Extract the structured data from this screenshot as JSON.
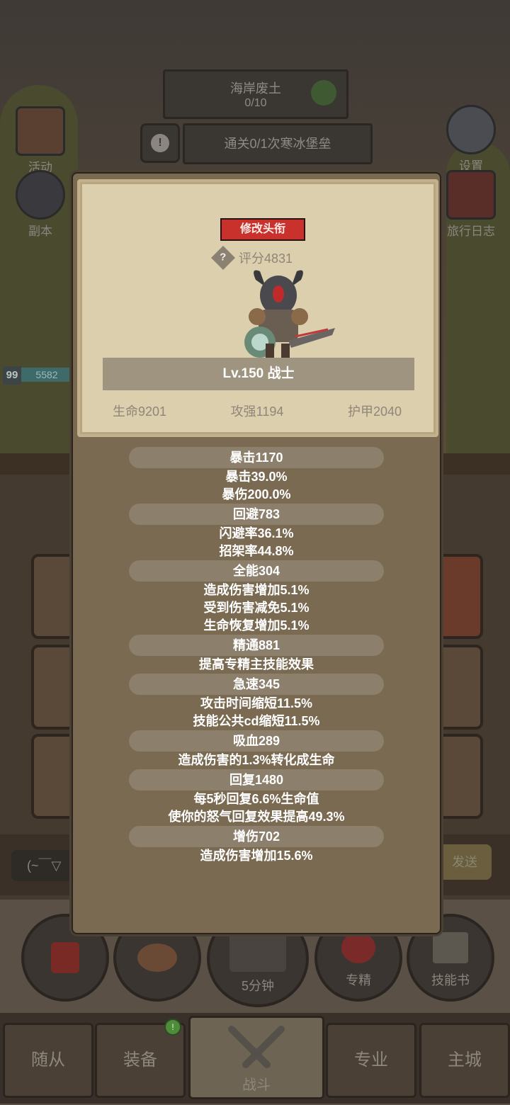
{
  "hud": {
    "zone_name": "海岸废土",
    "zone_progress": "0/10",
    "quest_text": "通关0/1次寒冰堡垒",
    "player_level": "99",
    "xp_value": "5582"
  },
  "side_buttons": {
    "left": [
      {
        "label": "活动",
        "icon": "scroll-icon"
      },
      {
        "label": "副本",
        "icon": "portal-icon"
      }
    ],
    "right": [
      {
        "label": "设置",
        "icon": "gear-icon"
      },
      {
        "label": "旅行日志",
        "icon": "book-icon"
      }
    ]
  },
  "chat": {
    "input_text": "(~￣▽",
    "send_label": "发送"
  },
  "action_buttons": [
    {
      "label": "",
      "icon": "potion-icon"
    },
    {
      "label": "",
      "icon": "bread-icon"
    },
    {
      "label": "5分钟",
      "icon": "chest-icon"
    },
    {
      "label": "专精",
      "icon": "specialization-icon"
    },
    {
      "label": "技能书",
      "icon": "skillbook-icon"
    }
  ],
  "nav": {
    "tabs": [
      "随从",
      "装备",
      "战斗",
      "专业",
      "主城"
    ],
    "active": "战斗",
    "badge": "!"
  },
  "modal": {
    "rename_label": "修改头衔",
    "score_label": "评分4831",
    "hero_title": "Lv.150 战士",
    "base_stats": [
      "生命9201",
      "攻强1194",
      "护甲2040"
    ],
    "stat_groups": [
      {
        "head": "暴击1170",
        "lines": [
          "暴击39.0%",
          "暴伤200.0%"
        ]
      },
      {
        "head": "回避783",
        "lines": [
          "闪避率36.1%",
          "招架率44.8%"
        ]
      },
      {
        "head": "全能304",
        "lines": [
          "造成伤害增加5.1%",
          "受到伤害减免5.1%",
          "生命恢复增加5.1%"
        ]
      },
      {
        "head": "精通881",
        "lines": [
          "提高专精主技能效果"
        ]
      },
      {
        "head": "急速345",
        "lines": [
          "攻击时间缩短11.5%",
          "技能公共cd缩短11.5%"
        ]
      },
      {
        "head": "吸血289",
        "lines": [
          "造成伤害的1.3%转化成生命"
        ]
      },
      {
        "head": "回复1480",
        "lines": [
          "每5秒回复6.6%生命值",
          "使你的怒气回复效果提高49.3%"
        ]
      },
      {
        "head": "增伤702",
        "lines": [
          "造成伤害增加15.6%"
        ]
      }
    ]
  }
}
